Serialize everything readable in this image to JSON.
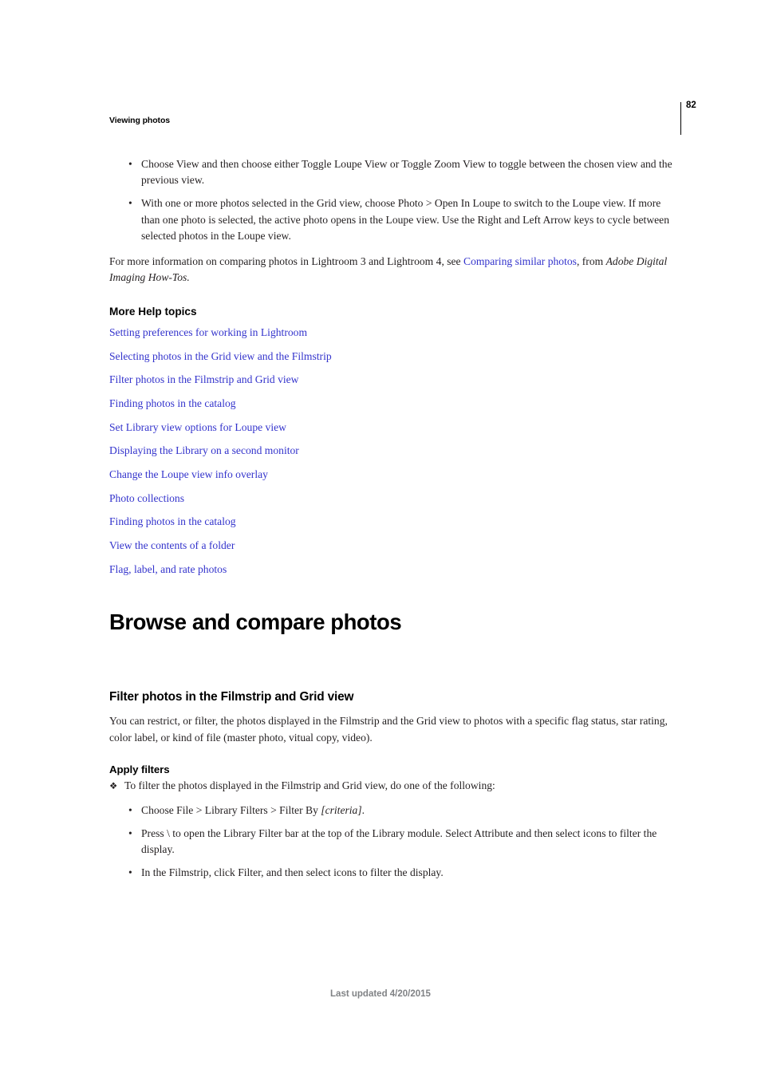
{
  "header": {
    "running_head": "Viewing photos",
    "page_number": "82"
  },
  "intro_bullets": [
    "Choose View and then choose either Toggle Loupe View or Toggle Zoom View to toggle between the chosen view and the previous view.",
    "With one or more photos selected in the Grid view, choose Photo > Open In Loupe to switch to the Loupe view. If more than one photo is selected, the active photo opens in the Loupe view. Use the Right and Left Arrow keys to cycle between selected photos in the Loupe view."
  ],
  "info_paragraph": {
    "before_link": "For more information on comparing photos in Lightroom 3 and Lightroom 4, see ",
    "link_text": "Comparing similar photos",
    "after_link": ", from ",
    "italic_tail": "Adobe Digital Imaging How-Tos."
  },
  "more_help": {
    "heading": "More Help topics",
    "links": [
      "Setting preferences for working in Lightroom",
      "Selecting photos in the Grid view and the Filmstrip",
      "Filter photos in the Filmstrip and Grid view",
      "Finding photos in the catalog",
      "Set Library view options for Loupe view",
      "Displaying the Library on a second monitor",
      "Change the Loupe view info overlay",
      "Photo collections",
      "Finding photos in the catalog",
      "View the contents of a folder",
      "Flag, label, and rate photos"
    ]
  },
  "chapter_heading": "Browse and compare photos",
  "section": {
    "heading": "Filter photos in the Filmstrip and Grid view",
    "body": "You can restrict, or filter, the photos displayed in the Filmstrip and the Grid view to photos with a specific flag status, star rating, color label, or kind of file (master photo, vitual copy, video)."
  },
  "apply_filters": {
    "heading": "Apply filters",
    "task": "To filter the photos displayed in the Filmstrip and Grid view, do one of the following:",
    "steps": [
      {
        "text": "Choose File > Library Filters > Filter By ",
        "italic": "[criteria]",
        "tail": "."
      },
      {
        "text": "Press \\ to open the Library Filter bar at the top of the Library module. Select Attribute and then select icons to filter the display.",
        "italic": "",
        "tail": ""
      },
      {
        "text": "In the Filmstrip, click Filter, and then select icons to filter the display.",
        "italic": "",
        "tail": ""
      }
    ]
  },
  "bullet_glyph": "•",
  "floret_glyph": "❖",
  "footer": "Last updated 4/20/2015",
  "colors": {
    "link": "#3333cc",
    "text": "#231f20",
    "footer": "#808285"
  }
}
